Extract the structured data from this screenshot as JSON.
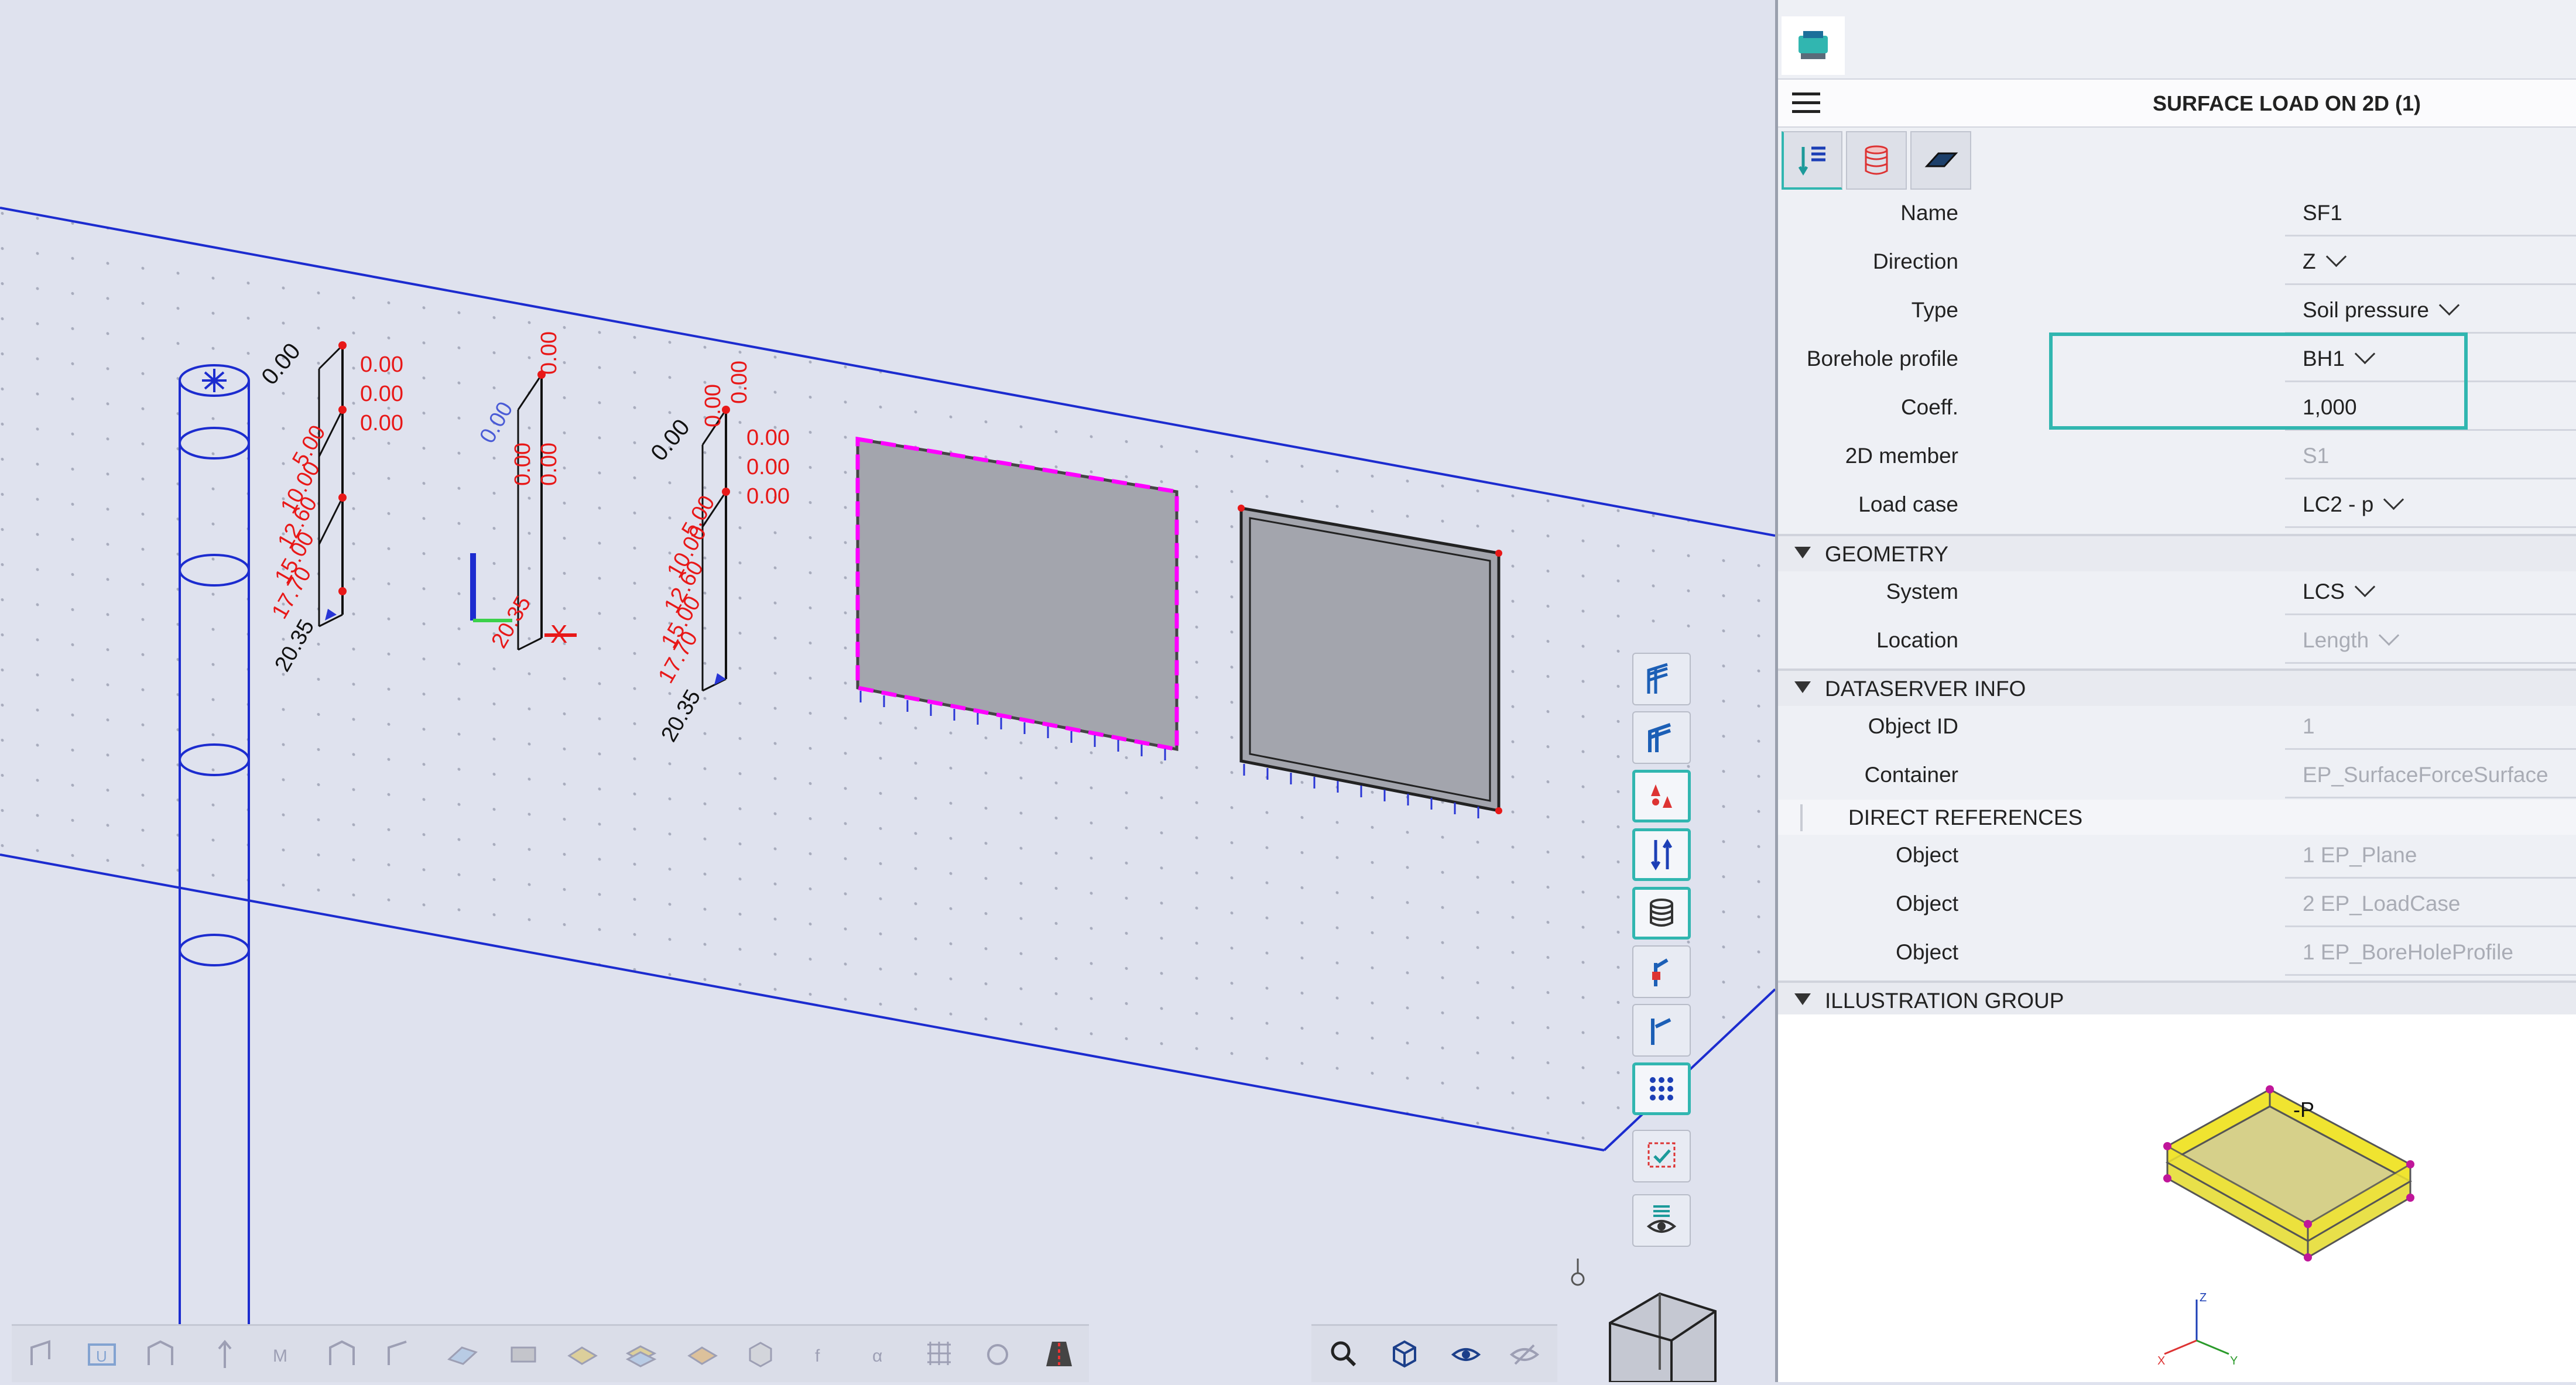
{
  "viewport": {
    "dim_labels": {
      "a": "0.00",
      "b": "5.00",
      "c": "10.00",
      "d": "12.60",
      "e": "15.00",
      "f": "17.70",
      "g": "20.35"
    },
    "axis_labels": {
      "x": "X",
      "y": "Y",
      "z": "Z"
    },
    "vertical_tools": [
      {
        "name": "ribs-tool-icon"
      },
      {
        "name": "members-tool-icon"
      },
      {
        "name": "loads-tool-icon"
      },
      {
        "name": "supports-tool-icon"
      },
      {
        "name": "dataserver-tool-icon"
      },
      {
        "name": "results-tool-icon"
      },
      {
        "name": "checks-tool-icon"
      },
      {
        "name": "points-grid-icon"
      },
      {
        "name": "selection-check-icon"
      },
      {
        "name": "display-eye-icon"
      }
    ],
    "bottom_tools": [
      "beam-icon",
      "u-icon",
      "frame-icon",
      "arrow-icon",
      "m-icon",
      "frame2-icon",
      "hinge-icon",
      "slab-icon",
      "plate-icon",
      "layer-icon",
      "stack-icon",
      "mesh-icon",
      "cube-icon",
      "f-icon",
      "a-icon",
      "grid-icon",
      "rotate-icon",
      "road-icon"
    ],
    "view_tools": [
      "zoom-icon",
      "view-cube-icon",
      "rotate-eye-icon",
      "hide-eye-icon"
    ]
  },
  "panel": {
    "title": "SURFACE LOAD ON 2D (1)",
    "properties": [
      {
        "label": "Name",
        "value": "SF1",
        "dropdown": false,
        "grey": false
      },
      {
        "label": "Direction",
        "value": "Z",
        "dropdown": true,
        "grey": false
      },
      {
        "label": "Type",
        "value": "Soil pressure",
        "dropdown": true,
        "grey": false
      },
      {
        "label": "Borehole profile",
        "value": "BH1",
        "dropdown": true,
        "grey": false
      },
      {
        "label": "Coeff.",
        "value": "1,000",
        "dropdown": false,
        "grey": false
      },
      {
        "label": "2D member",
        "value": "S1",
        "dropdown": false,
        "grey": true
      },
      {
        "label": "Load case",
        "value": "LC2 - p",
        "dropdown": true,
        "grey": false
      }
    ],
    "geometry": {
      "title": "GEOMETRY",
      "rows": [
        {
          "label": "System",
          "value": "LCS",
          "dropdown": true,
          "grey": false
        },
        {
          "label": "Location",
          "value": "Length",
          "dropdown": true,
          "grey": true
        }
      ]
    },
    "dataserver": {
      "title": "DATASERVER INFO",
      "rows": [
        {
          "label": "Object ID",
          "value": "1",
          "grey": true
        },
        {
          "label": "Container",
          "value": "EP_SurfaceForceSurface",
          "grey": true
        }
      ],
      "direct_refs_title": "DIRECT REFERENCES",
      "refs": [
        {
          "label": "Object",
          "value": "1 EP_Plane"
        },
        {
          "label": "Object",
          "value": "2 EP_LoadCase"
        },
        {
          "label": "Object",
          "value": "1 EP_BoreHoleProfile"
        }
      ]
    },
    "illustration": {
      "title": "ILLUSTRATION GROUP",
      "load_label": "-P"
    },
    "colors": {
      "accent": "#31b6b0",
      "model_blue": "#1c2ccf",
      "load_red": "#e81818",
      "selection_magenta": "#ff00ff"
    }
  }
}
